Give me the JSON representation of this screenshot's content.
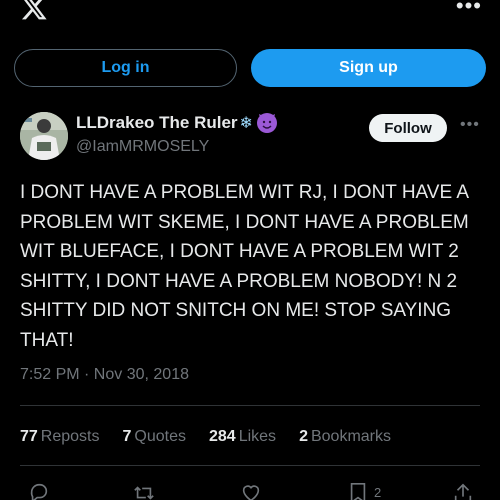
{
  "header": {
    "logo": "x-logo",
    "more_icon": "more-dots-icon"
  },
  "auth": {
    "login_label": "Log in",
    "signup_label": "Sign up"
  },
  "author": {
    "display_name": "LLDrakeo The Ruler",
    "emojis": [
      "snowflake-emoji",
      "smiling-devil-emoji"
    ],
    "handle": "@IamMRMOSELY",
    "follow_label": "Follow"
  },
  "tweet": {
    "text": "I DONT HAVE A PROBLEM WIT RJ, I DONT HAVE A PROBLEM WIT SKEME, I DONT HAVE A PROBLEM WIT BLUEFACE, I DONT HAVE A PROBLEM WIT 2 SHITTY, I DONT HAVE A PROBLEM NOBODY! N 2 SHITTY DID NOT SNITCH ON ME! STOP SAYING THAT!",
    "timestamp": "7:52 PM · Nov 30, 2018"
  },
  "stats": {
    "reposts_count": "77",
    "reposts_label": "Reposts",
    "quotes_count": "7",
    "quotes_label": "Quotes",
    "likes_count": "284",
    "likes_label": "Likes",
    "bookmarks_count": "2",
    "bookmarks_label": "Bookmarks"
  },
  "actions": {
    "reply_icon": "reply-icon",
    "repost_icon": "repost-icon",
    "like_icon": "heart-icon",
    "bookmark_icon": "bookmark-icon",
    "bookmark_count": "2",
    "share_icon": "share-icon"
  },
  "colors": {
    "accent": "#1d9bf0",
    "background": "#000000",
    "muted": "#71767b"
  }
}
